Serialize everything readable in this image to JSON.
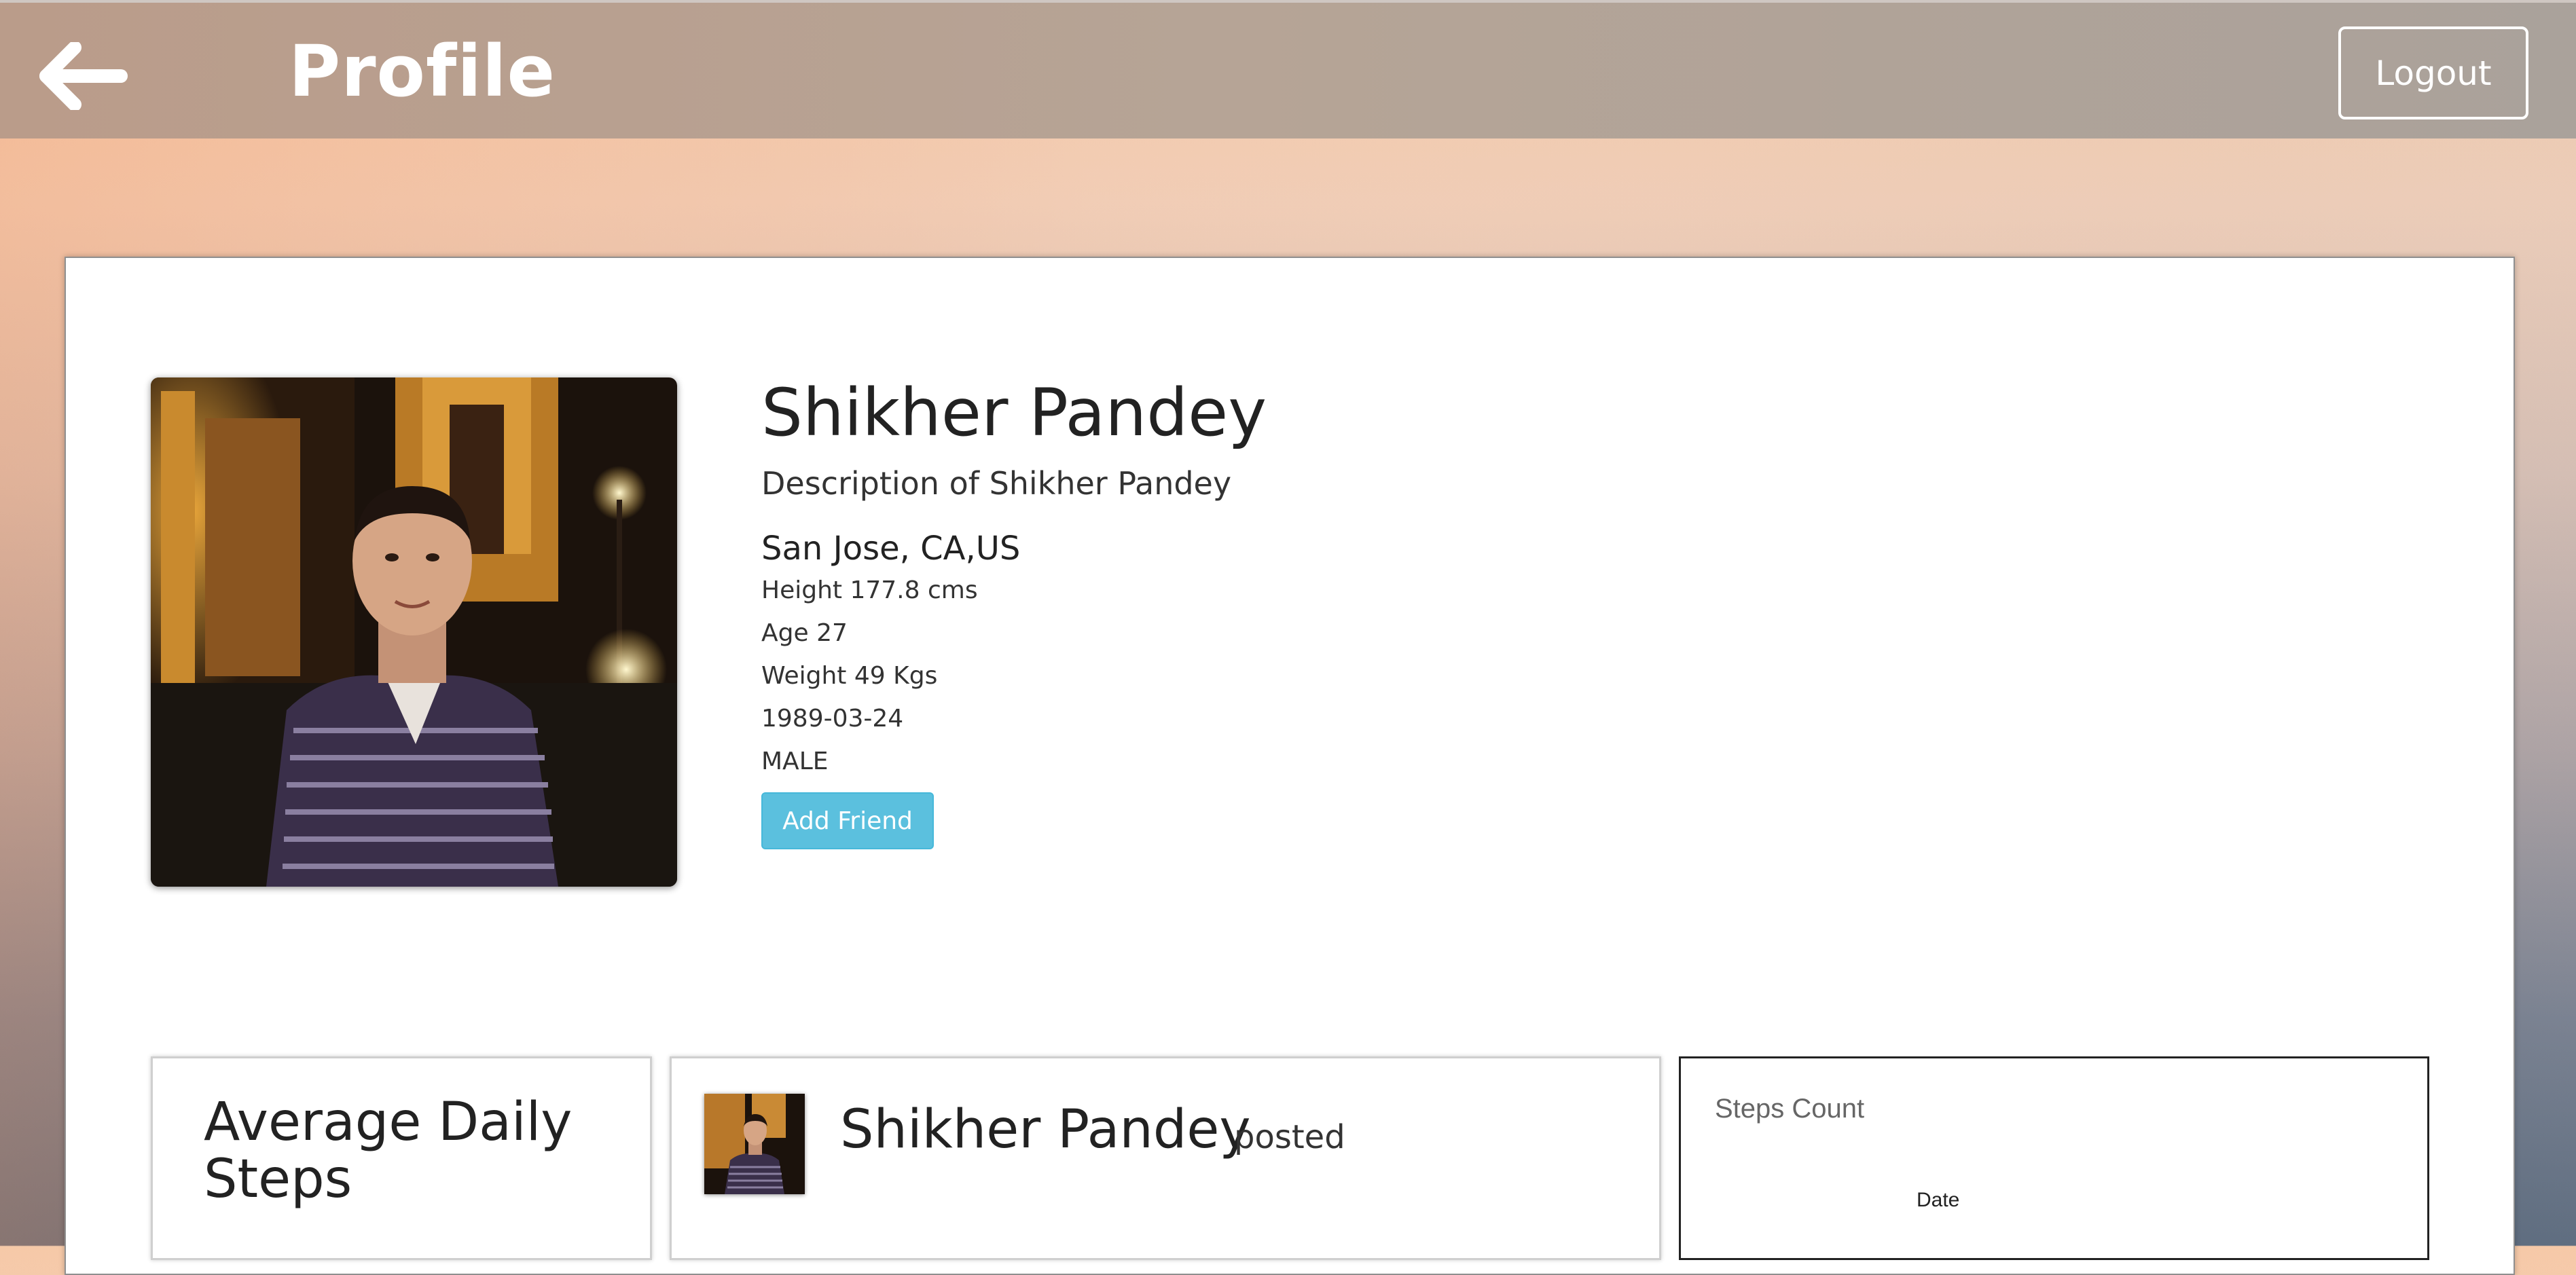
{
  "header": {
    "title": "Profile",
    "logout_label": "Logout"
  },
  "profile": {
    "name": "Shikher Pandey",
    "description": "Description of Shikher Pandey",
    "location": "San Jose, CA,US",
    "height": "Height 177.8 cms",
    "age": "Age 27",
    "weight": "Weight 49 Kgs",
    "dob": "1989-03-24",
    "gender": "MALE",
    "add_friend_label": "Add Friend"
  },
  "panels": {
    "avg_steps_title": "Average Daily Steps",
    "post": {
      "author": "Shikher Pandey",
      "verb": "posted"
    },
    "chart": {
      "title": "Steps Count",
      "xlabel": "Date"
    }
  },
  "colors": {
    "accent_button": "#5bc0de"
  },
  "icons": {
    "back": "back-arrow-icon"
  }
}
